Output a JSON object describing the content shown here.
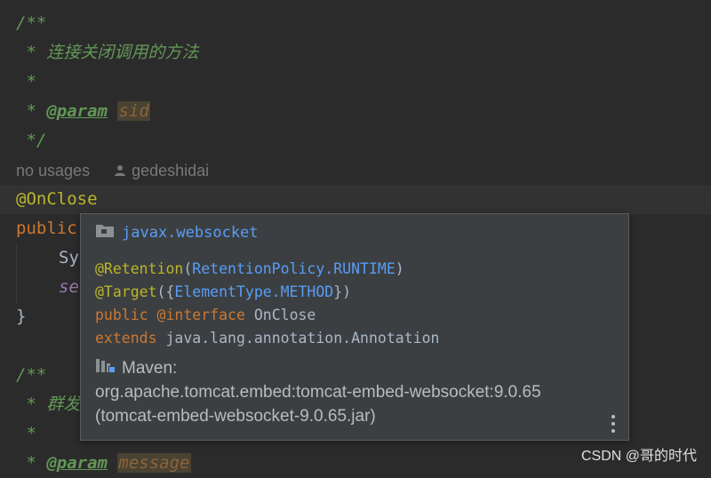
{
  "editor": {
    "doc1": {
      "open": "/**",
      "star": "*",
      "desc": "连接关闭调用的方法",
      "param_tag": "@param",
      "param_name": "sid",
      "close": "*/"
    },
    "hint": {
      "usages": "no usages",
      "author": "gedeshidai"
    },
    "annotation": "@OnClose",
    "method_start": "public",
    "body_line1": "Sy",
    "body_line2": "se",
    "brace_close": "}",
    "doc2": {
      "open": "/**",
      "desc_partial": "群发",
      "param_tag": "@param",
      "param_name": "message"
    }
  },
  "popup": {
    "package": "javax.websocket",
    "retention_ann": "@Retention",
    "retention_arg": "RetentionPolicy.RUNTIME",
    "target_ann": "@Target",
    "target_arg": "ElementType.METHOD",
    "decl_public": "public",
    "decl_at": "@",
    "decl_interface": "interface",
    "decl_name": "OnClose",
    "extends_kw": "extends",
    "extends_type": "java.lang.annotation.Annotation",
    "maven_label": "Maven:",
    "artifact_line1": "org.apache.tomcat.embed:tomcat-embed-websocket:9.0.65",
    "artifact_line2": "(tomcat-embed-websocket-9.0.65.jar)"
  },
  "watermark": "CSDN @哥的时代",
  "colors": {
    "background": "#2b2b2b",
    "comment": "#629755",
    "annotation": "#bbb529",
    "keyword": "#cc7832",
    "link": "#589df6",
    "popup_bg": "#3c3f41"
  },
  "icons": [
    "person-icon",
    "package-folder-icon",
    "maven-library-icon",
    "more-vertical-icon"
  ]
}
